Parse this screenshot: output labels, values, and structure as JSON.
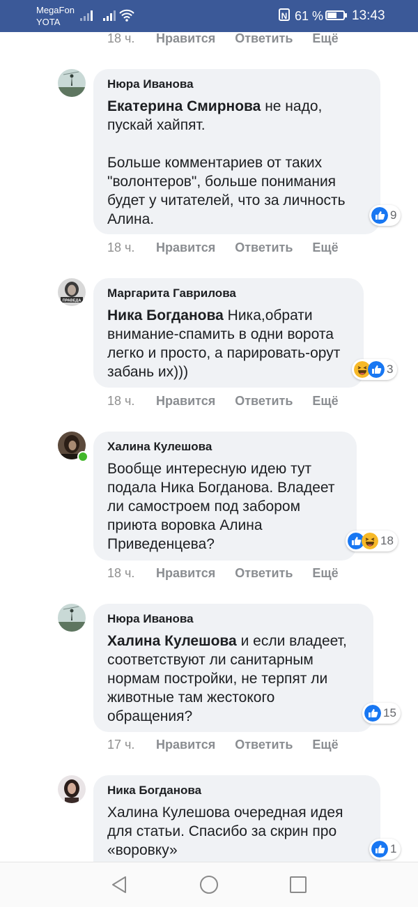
{
  "status_bar": {
    "carrier_top": "MegaFon",
    "carrier_bottom": "YOTA",
    "battery_percent_label": "61 %",
    "battery_level": 0.61,
    "time": "13:43"
  },
  "actions_labels": {
    "like": "Нравится",
    "reply": "Ответить",
    "more": "Ещё"
  },
  "top_action_row": {
    "time": "18 ч."
  },
  "comments": [
    {
      "author": "Нюра Иванова",
      "mention": "Екатерина Смирнова",
      "text": " не надо, пускай хайпят.\n\nБольше комментариев от таких \"волонтеров\", больше понимания будет у читателей, что за личность Алина.",
      "reactions": [
        "like"
      ],
      "reaction_count": "9",
      "time": "18 ч."
    },
    {
      "author": "Маргарита Гаврилова",
      "mention": "Ника Богданова",
      "text": " Ника,обрати внимание-спамить в одни ворота легко и просто, а парировать-орут забань их)))",
      "reactions": [
        "haha",
        "like"
      ],
      "reaction_count": "3",
      "avatar_text": "ПРАВЕДА",
      "time": "18 ч."
    },
    {
      "author": "Халина Кулешова",
      "mention": "",
      "text": "Вообще интересную идею тут подала Ника Богданова. Владеет ли самостроем под забором приюта воровка Алина Приведенцева?",
      "reactions": [
        "like",
        "haha"
      ],
      "reaction_count": "18",
      "time": "18 ч."
    },
    {
      "author": "Нюра Иванова",
      "mention": "Халина Кулешова",
      "text": " и если владеет, соответствуют ли санитарным нормам постройки, не терпят ли животные там жестокого обращения?",
      "reactions": [
        "like"
      ],
      "reaction_count": "15",
      "time": "17 ч."
    },
    {
      "author": "Ника Богданова",
      "mention": "",
      "text": "Халина Кулешова очередная идея для статьи. Спасибо за скрин про «воровку»",
      "reactions": [
        "like"
      ],
      "reaction_count": "1",
      "time": ""
    }
  ],
  "nav_icons": [
    "back-icon",
    "home-icon",
    "recents-icon"
  ],
  "colors": {
    "status_bar": "#3b5998",
    "bubble": "#f0f2f5",
    "like_blue": "#1877f2",
    "haha_yellow": "#f7b928",
    "online_green": "#42b72a"
  }
}
